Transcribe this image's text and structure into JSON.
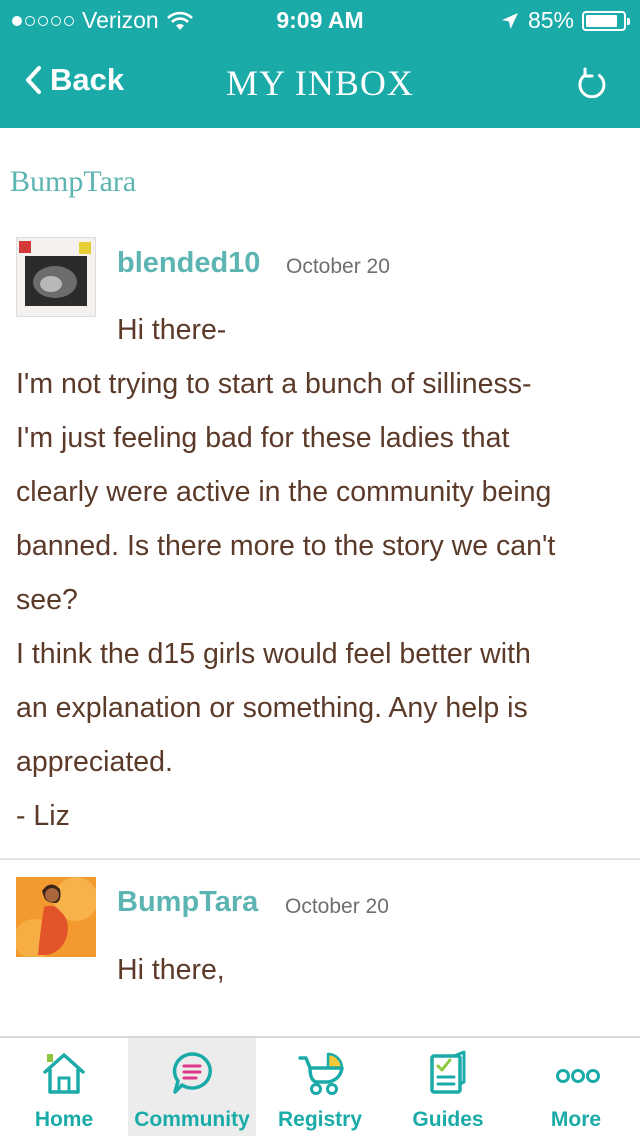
{
  "status_bar": {
    "carrier": "Verizon",
    "time": "9:09 AM",
    "battery": "85%",
    "battery_level": 0.85,
    "signal_bars_filled": 1,
    "signal_bars_total": 5
  },
  "header": {
    "back_label": "Back",
    "title": "MY INBOX",
    "color": "#1aaba8"
  },
  "thread": {
    "title": "BumpTara"
  },
  "messages": [
    {
      "sender": "blended10",
      "date": "October 20",
      "greeting": "Hi there-",
      "lines": [
        "I'm not trying to start a bunch of silliness-",
        "I'm just feeling bad for these ladies that",
        "clearly were active in the community being",
        "banned. Is there more to the story we can't",
        "see?",
        "I think the d15 girls would feel better with",
        "an explanation or something. Any help is",
        "appreciated.",
        "- Liz"
      ]
    },
    {
      "sender": "BumpTara",
      "date": "October 20",
      "greeting": "Hi there,"
    }
  ],
  "tabs": [
    {
      "label": "Home",
      "icon": "home-icon"
    },
    {
      "label": "Community",
      "icon": "chat-icon",
      "active": true
    },
    {
      "label": "Registry",
      "icon": "stroller-icon"
    },
    {
      "label": "Guides",
      "icon": "checklist-icon"
    },
    {
      "label": "More",
      "icon": "more-dots-icon"
    }
  ],
  "colors": {
    "accent": "#1aaba8",
    "sender": "#5cb5b2",
    "body_text": "#5b3a29",
    "community_pink": "#e0398a",
    "registry_yellow": "#f3c93a"
  }
}
